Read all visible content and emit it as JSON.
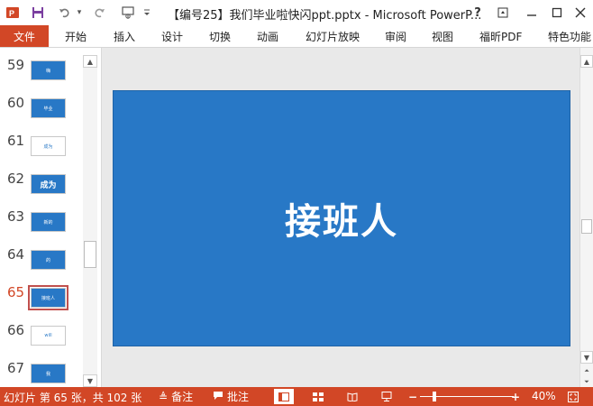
{
  "window": {
    "title": "【编号25】我们毕业啦快闪ppt.pptx - Microsoft PowerP...",
    "help": "?"
  },
  "quick_access": {
    "app_icon": "powerpoint-icon",
    "undo_dropdown": "▾"
  },
  "ribbon": {
    "file_tab": "文件",
    "tabs": [
      "开始",
      "插入",
      "设计",
      "切换",
      "动画",
      "幻灯片放映",
      "审阅",
      "视图",
      "福昕PDF",
      "特色功能"
    ]
  },
  "thumbnails": [
    {
      "num": "59",
      "style": "blue",
      "text": "嗨",
      "selected": false
    },
    {
      "num": "60",
      "style": "blue",
      "text": "毕业",
      "selected": false
    },
    {
      "num": "61",
      "style": "white",
      "text": "成为",
      "selected": false
    },
    {
      "num": "62",
      "style": "blue",
      "text": "成为",
      "selected": false
    },
    {
      "num": "63",
      "style": "blue",
      "text": "新的",
      "selected": false
    },
    {
      "num": "64",
      "style": "blue",
      "text": "的",
      "selected": false
    },
    {
      "num": "65",
      "style": "blue",
      "text": "接班人",
      "selected": true
    },
    {
      "num": "66",
      "style": "white",
      "text": "will",
      "selected": false
    },
    {
      "num": "67",
      "style": "blue",
      "text": "我",
      "selected": false
    }
  ],
  "slide": {
    "title": "接班人",
    "background": "#2878c6"
  },
  "status": {
    "slide_info": "幻灯片 第 65 张，共 102 张",
    "notes": "备注",
    "comments": "批注",
    "zoom": "40%",
    "zoom_fraction": 0.15
  },
  "colors": {
    "accent": "#d24726",
    "slide_blue": "#2878c6"
  }
}
